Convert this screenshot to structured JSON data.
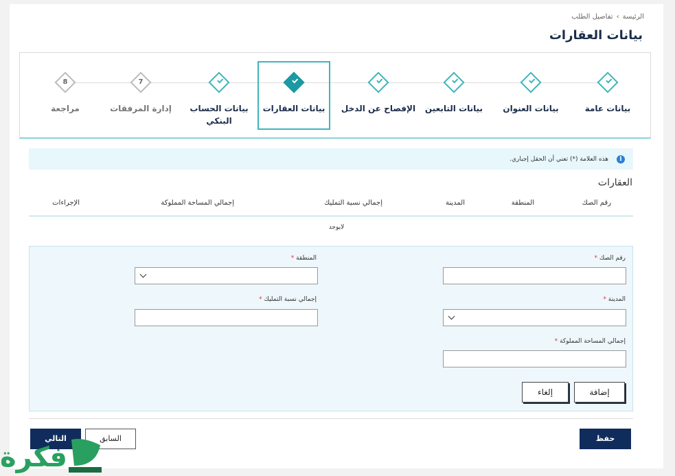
{
  "breadcrumb": {
    "home": "الرئيسة",
    "sep": "›",
    "current": "تفاصيل الطلب"
  },
  "page_title": "بيانات العقارات",
  "steps": [
    {
      "label": "بيانات عامة",
      "state": "done"
    },
    {
      "label": "بيانات العنوان",
      "state": "done"
    },
    {
      "label": "بيانات التابعين",
      "state": "done"
    },
    {
      "label": "الإفصاح عن الدخل",
      "state": "done"
    },
    {
      "label": "بيانات العقارات",
      "state": "active"
    },
    {
      "label": "بيانات الحساب البنكي",
      "state": "done"
    },
    {
      "label": "إدارة المرفقات",
      "state": "pending",
      "number": "7"
    },
    {
      "label": "مراجعة",
      "state": "pending",
      "number": "8"
    }
  ],
  "info": {
    "text": "هذه العلامة (*) تعني أن الحقل إجباري."
  },
  "section_title": "العقارات",
  "table": {
    "headers": [
      "رقم الصك",
      "المنطقة",
      "المدينة",
      "إجمالي نسبة التمليك",
      "إجمالي المساحة المملوكة",
      "الإجراءات"
    ],
    "empty_text": "لايوجد"
  },
  "form": {
    "deed_label": "رقم الصك",
    "region_label": "المنطقة",
    "city_label": "المدينة",
    "ownership_label": "إجمالي نسبة التمليك",
    "area_label": "إجمالي المساحة المملوكة",
    "required_mark": "*",
    "add_button": "إضافة",
    "cancel_button": "إلغاء"
  },
  "footer": {
    "save": "حفظ",
    "next": "التالي",
    "prev": "السابق"
  },
  "watermark": "فكرة",
  "colors": {
    "navy": "#102c5c",
    "teal": "#1b9aa3",
    "info_bg": "#e7f7fb",
    "form_bg": "#eef7fb"
  }
}
